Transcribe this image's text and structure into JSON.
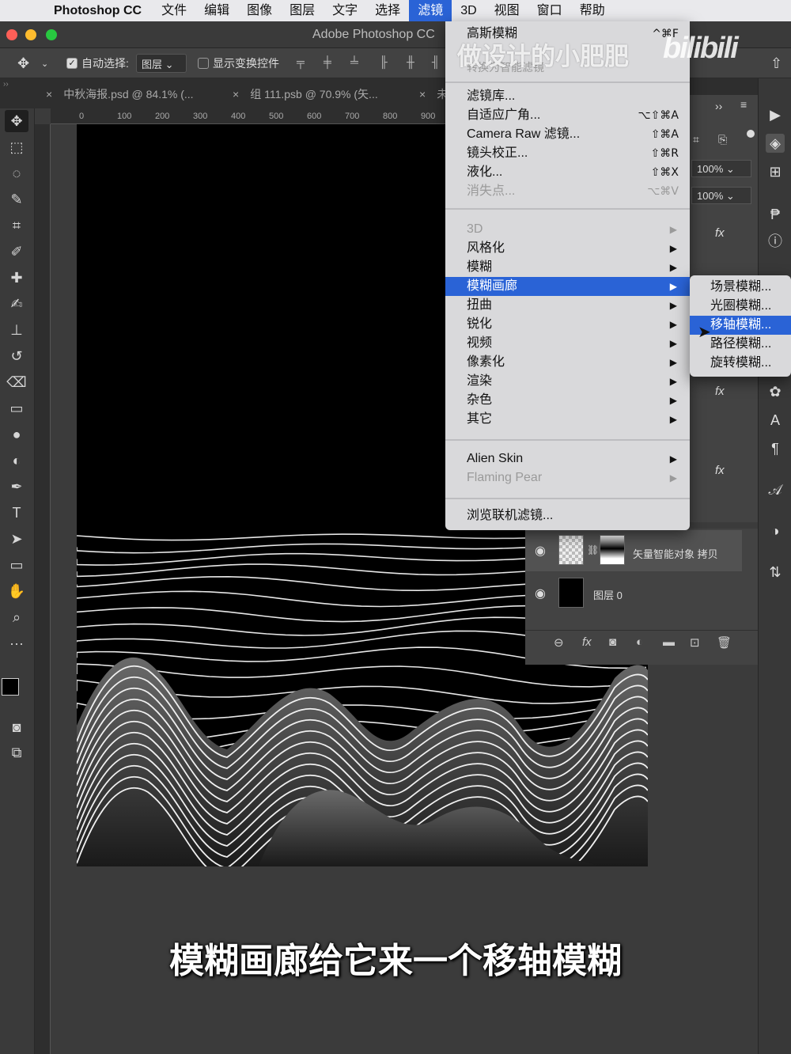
{
  "menubar": {
    "app": "Photoshop CC",
    "items": [
      "文件",
      "编辑",
      "图像",
      "图层",
      "文字",
      "选择",
      "滤镜",
      "3D",
      "视图",
      "窗口",
      "帮助"
    ],
    "active_index": 6
  },
  "window": {
    "title": "Adobe Photoshop CC"
  },
  "options": {
    "auto_select_label": "自动选择:",
    "auto_select_value": "图层",
    "show_transform_label": "显示变换控件"
  },
  "tabs": [
    {
      "label": "中秋海报.psd @ 84.1% (..."
    },
    {
      "label": "组 111.psb @ 70.9% (矢..."
    },
    {
      "label": "未"
    }
  ],
  "ruler": {
    "ticks": [
      "0",
      "100",
      "200",
      "300",
      "400",
      "500",
      "600",
      "700",
      "800",
      "900"
    ]
  },
  "filter_menu": {
    "top": [
      {
        "label": "高斯模糊",
        "shortcut": "^⌘F"
      },
      {
        "label": "转换为智能滤镜",
        "disabled": true
      }
    ],
    "group1": [
      {
        "label": "滤镜库...",
        "shortcut": ""
      },
      {
        "label": "自适应广角...",
        "shortcut": "⌥⇧⌘A"
      },
      {
        "label": "Camera Raw 滤镜...",
        "shortcut": "⇧⌘A"
      },
      {
        "label": "镜头校正...",
        "shortcut": "⇧⌘R"
      },
      {
        "label": "液化...",
        "shortcut": "⇧⌘X"
      },
      {
        "label": "消失点...",
        "shortcut": "⌥⌘V"
      }
    ],
    "group2": [
      "3D",
      "风格化",
      "模糊",
      "模糊画廊",
      "扭曲",
      "锐化",
      "视频",
      "像素化",
      "渲染",
      "杂色",
      "其它"
    ],
    "group3": [
      "Alien Skin",
      "Flaming Pear"
    ],
    "browse": "浏览联机滤镜..."
  },
  "submenu": [
    "场景模糊...",
    "光圈模糊...",
    "移轴模糊...",
    "路径模糊...",
    "旋转模糊..."
  ],
  "panels": {
    "zoom1": "100%",
    "zoom2": "100%",
    "fx_label": "fx"
  },
  "layers": [
    {
      "name": "矢量智能对象 拷贝"
    },
    {
      "name": "图层 0"
    }
  ],
  "overlay": {
    "watermark": "做设计的小肥肥",
    "platform": "bilibili",
    "subtitle": "模糊画廊给它来一个移轴模糊"
  },
  "colors": {
    "accent": "#2a63d6",
    "menu_bg": "#d9d9db",
    "panel_bg": "#434343"
  }
}
